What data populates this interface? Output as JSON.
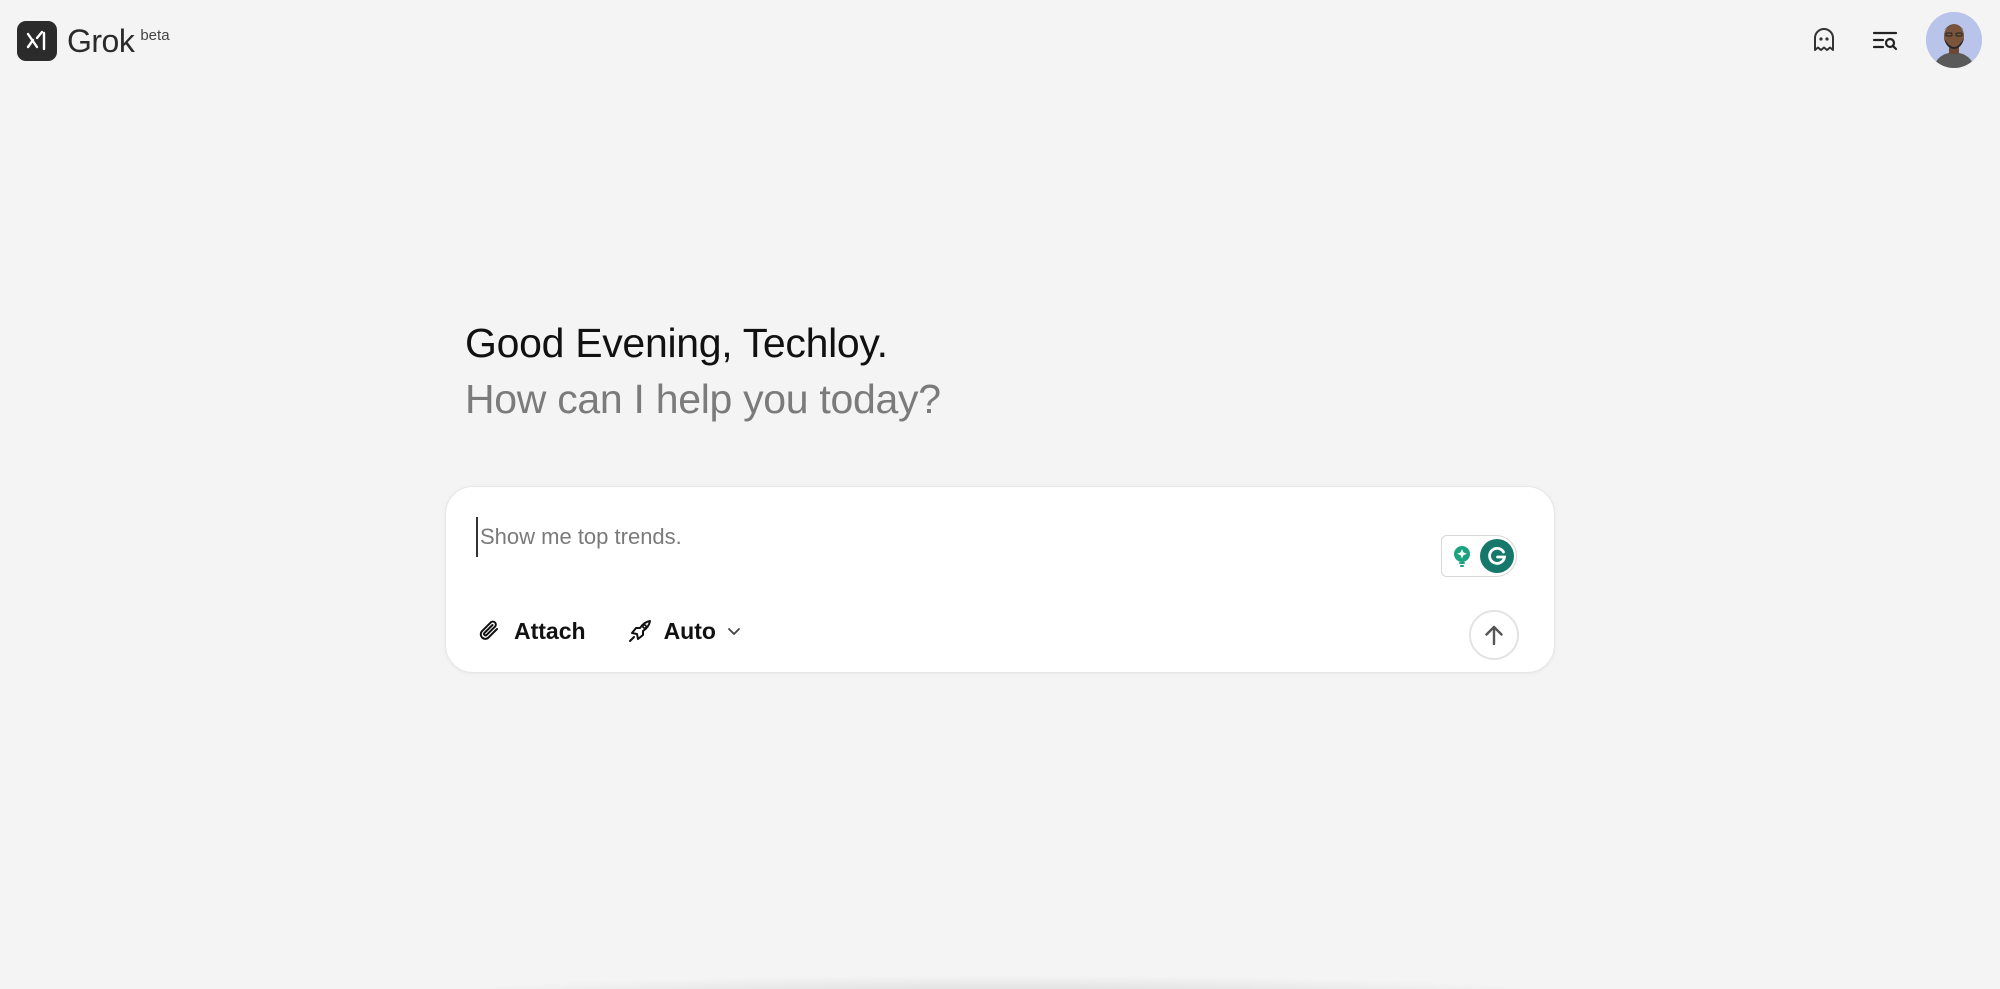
{
  "app": {
    "name": "Grok",
    "badge": "beta"
  },
  "header": {
    "icons": [
      "ghost-icon",
      "search-history-icon"
    ],
    "avatar": "user-avatar"
  },
  "greeting": {
    "title": "Good Evening, Techloy.",
    "subtitle": "How can I help you today?"
  },
  "composer": {
    "placeholder": "Show me top trends.",
    "value": "",
    "attach_label": "Attach",
    "mode_label": "Auto",
    "send_icon": "arrow-up-icon"
  },
  "colors": {
    "background": "#f4f4f4",
    "accent_grammarly": "#15786a",
    "bulb": "#1aa37f"
  }
}
